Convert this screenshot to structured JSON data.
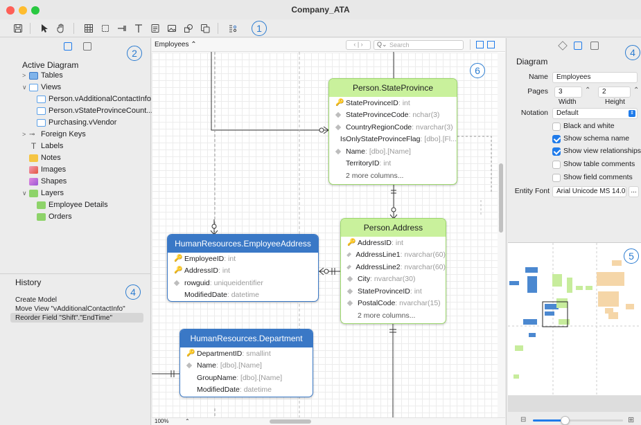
{
  "window": {
    "title": "Company_ATA"
  },
  "callouts": {
    "c1": "1",
    "c2": "2",
    "c3": "4",
    "c4": "6",
    "c5": "4",
    "c6": "5"
  },
  "toolbar": {
    "icons": [
      "save-icon",
      "pointer-icon",
      "hand-icon",
      "table-icon",
      "view-icon",
      "foreign-key-icon",
      "label-icon",
      "note-icon",
      "image-icon",
      "shape-icon",
      "layer-icon",
      "settings-icon"
    ]
  },
  "left_panel": {
    "section_title": "Active Diagram",
    "items": {
      "tables": "Tables",
      "views": "Views",
      "view1": "Person.vAdditionalContactInfo",
      "view2": "Person.vStateProvinceCount...",
      "view3": "Purchasing.vVendor",
      "foreign_keys": "Foreign Keys",
      "labels": "Labels",
      "notes": "Notes",
      "images": "Images",
      "shapes": "Shapes",
      "layers": "Layers",
      "layer1": "Employee Details",
      "layer2": "Orders"
    },
    "history_title": "History",
    "history": [
      "Create Model",
      "Move View \"vAdditionalContactInfo\"",
      "Reorder Field \"Shift\".\"EndTime\""
    ]
  },
  "canvas": {
    "diagram_selector": "Employees ⌃",
    "search_placeholder": "Search",
    "zoom": "100%",
    "zoom_arrow": "⌃"
  },
  "entities": {
    "state_province": {
      "title": "Person.StateProvince",
      "rows": [
        {
          "name": "StateProvinceID",
          "type": ": int"
        },
        {
          "name": "StateProvinceCode",
          "type": ": nchar(3)"
        },
        {
          "name": "CountryRegionCode",
          "type": ": nvarchar(3)"
        },
        {
          "name": "IsOnlyStateProvinceFlag",
          "type": ": [dbo].[Fl..."
        },
        {
          "name": "Name",
          "type": ": [dbo].[Name]"
        },
        {
          "name": "TerritoryID",
          "type": ": int"
        }
      ],
      "more": "2 more columns..."
    },
    "address": {
      "title": "Person.Address",
      "rows": [
        {
          "name": "AddressID",
          "type": ": int"
        },
        {
          "name": "AddressLine1",
          "type": ": nvarchar(60)"
        },
        {
          "name": "AddressLine2",
          "type": ": nvarchar(60)"
        },
        {
          "name": "City",
          "type": ": nvarchar(30)"
        },
        {
          "name": "StateProvinceID",
          "type": ": int"
        },
        {
          "name": "PostalCode",
          "type": ": nvarchar(15)"
        }
      ],
      "more": "2 more columns..."
    },
    "employee_address": {
      "title": "HumanResources.EmployeeAddress",
      "rows": [
        {
          "name": "EmployeeID",
          "type": ": int"
        },
        {
          "name": "AddressID",
          "type": ": int"
        },
        {
          "name": "rowguid",
          "type": ": uniqueidentifier"
        },
        {
          "name": "ModifiedDate",
          "type": ": datetime"
        }
      ]
    },
    "department": {
      "title": "HumanResources.Department",
      "rows": [
        {
          "name": "DepartmentID",
          "type": ": smallint"
        },
        {
          "name": "Name",
          "type": ": [dbo].[Name]"
        },
        {
          "name": "GroupName",
          "type": ": [dbo].[Name]"
        },
        {
          "name": "ModifiedDate",
          "type": ": datetime"
        }
      ]
    }
  },
  "right_panel": {
    "section_title": "Diagram",
    "name_label": "Name",
    "name_value": "Employees",
    "pages_label": "Pages",
    "pages_width": "3",
    "pages_height": "2",
    "width_label": "Width",
    "height_label": "Height",
    "notation_label": "Notation",
    "notation_value": "Default",
    "checks": {
      "black_white": "Black and white",
      "schema_name": "Show schema name",
      "view_relationships": "Show view relationships",
      "table_comments": "Show table comments",
      "field_comments": "Show field comments"
    },
    "entity_font_label": "Entity Font",
    "entity_font_value": "Arial Unicode MS 14.0",
    "entity_font_button": "...",
    "slider_level": 0.35
  },
  "colors": {
    "green_header": "#c9f19c",
    "blue_header": "#3a78c6",
    "accent": "#1f7bea"
  }
}
